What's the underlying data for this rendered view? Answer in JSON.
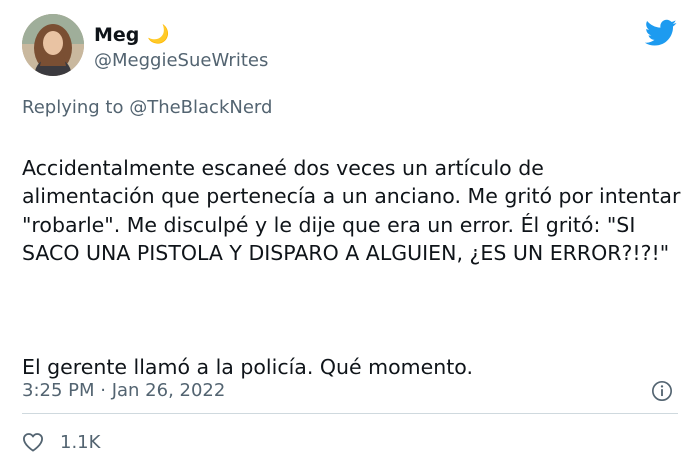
{
  "author": {
    "display_name": "Meg",
    "emoji_icon": "crescent-moon-icon",
    "emoji_glyph": "🌙",
    "handle": "@MeggieSueWrites"
  },
  "brand": {
    "icon": "twitter-bird-icon",
    "color": "#1d9bf0"
  },
  "reply": {
    "prefix": "Replying to ",
    "to": "@TheBlackNerd"
  },
  "tweet": {
    "paragraph_1": "Accidentalmente escaneé dos veces un artículo de alimentación que pertenecía a un anciano. Me gritó por intentar \"robarle\". Me disculpé y le dije que era un error. Él gritó: \"SI SACO UNA PISTOLA Y DISPARO A ALGUIEN, ¿ES UN ERROR?!?!\"",
    "paragraph_2": "El gerente llamó a la policía. Qué momento."
  },
  "meta": {
    "timestamp": "3:25 PM · Jan 26, 2022",
    "info_icon": "info-icon"
  },
  "engagement": {
    "like_icon": "heart-icon",
    "like_count": "1.1K"
  },
  "colors": {
    "text": "#0f1419",
    "secondary": "#536471",
    "divider": "#cfd9de"
  }
}
